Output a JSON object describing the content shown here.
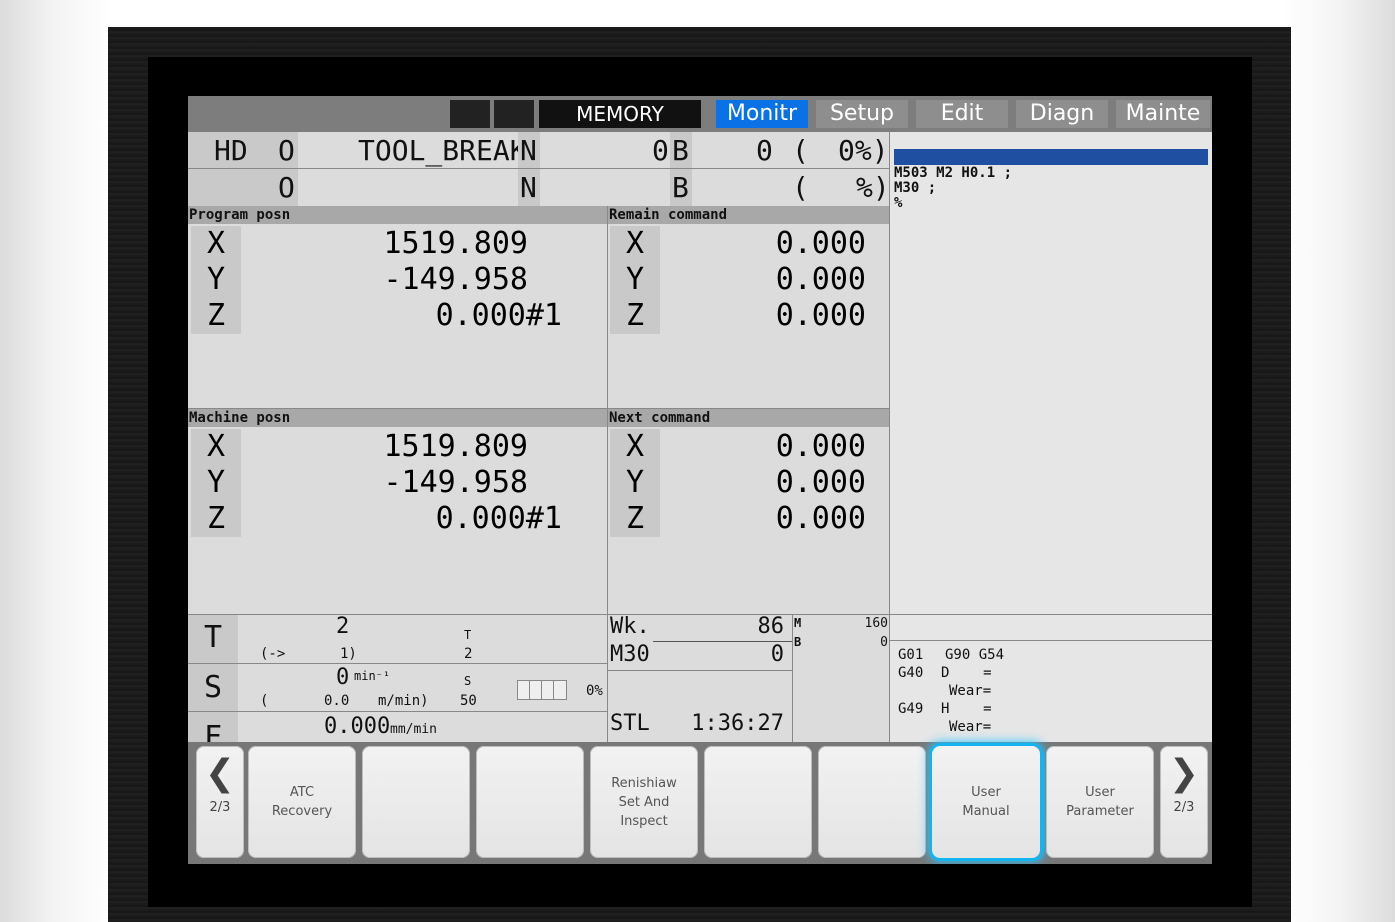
{
  "top_bar": {
    "mode": "MEMORY",
    "tabs": [
      "Monitr",
      "Setup",
      "Edit",
      "Diagn",
      "Mainte"
    ],
    "active_tab": "Monitr"
  },
  "status": {
    "row1": {
      "hd": "HD",
      "o": "O",
      "name": "TOOL_BREAK",
      "n": "N",
      "n_val": "0",
      "b": "B",
      "b_val": "0",
      "paren_open": "(",
      "pct": "0%)"
    },
    "row2": {
      "o": "O",
      "n": "N",
      "b": "B",
      "paren_open": "(",
      "pct": "%)"
    }
  },
  "program_posn": {
    "title": "Program posn",
    "axes": [
      {
        "axis": "X",
        "value": "1519.809"
      },
      {
        "axis": "Y",
        "value": "-149.958"
      },
      {
        "axis": "Z",
        "value": "0.000#1"
      }
    ]
  },
  "remain_command": {
    "title": "Remain command",
    "axes": [
      {
        "axis": "X",
        "value": "0.000"
      },
      {
        "axis": "Y",
        "value": "0.000"
      },
      {
        "axis": "Z",
        "value": "0.000"
      }
    ]
  },
  "machine_posn": {
    "title": "Machine posn",
    "axes": [
      {
        "axis": "X",
        "value": "1519.809"
      },
      {
        "axis": "Y",
        "value": "-149.958"
      },
      {
        "axis": "Z",
        "value": "0.000#1"
      }
    ]
  },
  "next_command": {
    "title": "Next command",
    "axes": [
      {
        "axis": "X",
        "value": "0.000"
      },
      {
        "axis": "Y",
        "value": "0.000"
      },
      {
        "axis": "Z",
        "value": "0.000"
      }
    ]
  },
  "program_listing": {
    "lines": [
      "M503 M2 H0.1 ;",
      "M30 ;",
      "%"
    ]
  },
  "tool": {
    "t_label": "T",
    "t_value": "2",
    "arrow": "(->",
    "sub": "1)",
    "t_small": "T",
    "t_small_val": "2"
  },
  "spindle": {
    "s_label": "S",
    "s_value": "0",
    "unit": "min⁻¹",
    "paren": "(",
    "speed": "0.0",
    "speed_unit": "m/min)",
    "s_small": "S",
    "s_small_val": "50",
    "load_pct": "0%"
  },
  "feed": {
    "f_label": "F",
    "f_value": "0.000",
    "unit": "mm/min"
  },
  "counters": {
    "wk_label": "Wk.",
    "wk_value": "86",
    "m30_label": "M30",
    "m30_value": "0",
    "stl_label": "STL",
    "stl_value": "1:36:27",
    "m_label": "M",
    "m_value": "160",
    "b_label": "B",
    "b_value": "0"
  },
  "modal": {
    "lines": [
      {
        "a": "G01",
        "b": "G90 G54"
      },
      {
        "a": "G40",
        "b": "D    ="
      },
      {
        "a": "",
        "b": "Wear="
      },
      {
        "a": "G49",
        "b": "H    ="
      },
      {
        "a": "",
        "b": "Wear="
      }
    ]
  },
  "softkeys": {
    "prev_page": "2/3",
    "next_page": "2/3",
    "keys": [
      "ATC\nRecovery",
      "",
      "",
      "Renishiaw\nSet And\nInspect",
      "",
      "",
      "User\nManual",
      "User\nParameter"
    ],
    "selected": "User\nManual"
  },
  "colors": {
    "active_tab": "#0a72e6",
    "highlight": "#14b4f0",
    "cursor_bar": "#1f4fa0"
  }
}
